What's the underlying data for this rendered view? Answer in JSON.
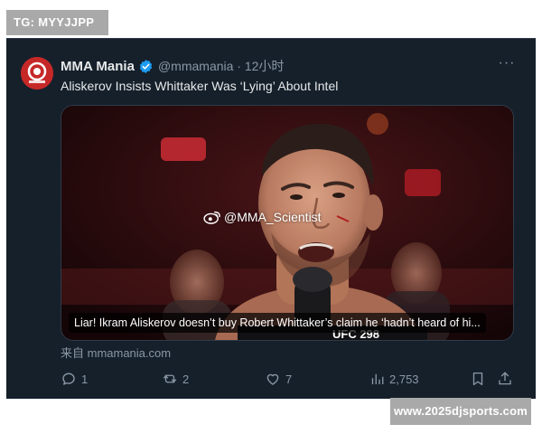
{
  "overlay_tag": "TG: MYYJJPP",
  "site_watermark": "www.2025djsports.com",
  "tweet": {
    "display_name": "MMA Mania",
    "handle_time": "@mmamania · 12小时",
    "more_label": "···",
    "text": "Aliskerov Insists Whittaker Was ‘Lying’ About Intel",
    "media": {
      "watermark_text": "@MMA_Scientist",
      "caption": "Liar! Ikram Aliskerov doesn’t buy Robert Whittaker’s claim he ‘hadn’t heard of hi...",
      "shirt_text": "UFC 298"
    },
    "source": "来自 mmamania.com",
    "actions": {
      "replies": "1",
      "retweets": "2",
      "likes": "7",
      "views": "2,753"
    }
  },
  "colors": {
    "card_bg": "#15202b",
    "text_primary": "#e7e9ea",
    "text_secondary": "#8b98a5",
    "verified_blue": "#1d9bf0",
    "avatar_red": "#c62828"
  },
  "icons": [
    "reply-icon",
    "retweet-icon",
    "like-icon",
    "views-icon",
    "bookmark-icon",
    "share-icon",
    "verified-icon",
    "weibo-icon"
  ]
}
